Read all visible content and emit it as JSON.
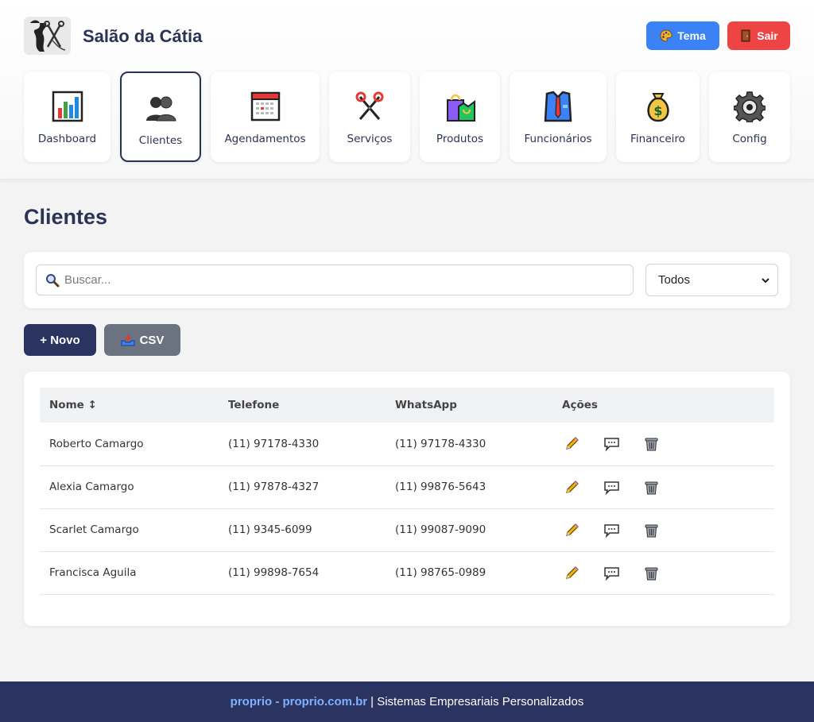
{
  "app": {
    "brand": "Salão da Cátia"
  },
  "header": {
    "theme_label": "Tema",
    "logout_label": "Sair"
  },
  "nav": [
    {
      "label": "Dashboard",
      "icon": "chart-icon"
    },
    {
      "label": "Clientes",
      "icon": "users-icon",
      "active": true
    },
    {
      "label": "Agendamentos",
      "icon": "calendar-icon"
    },
    {
      "label": "Serviços",
      "icon": "scissors-icon"
    },
    {
      "label": "Produtos",
      "icon": "shopping-bag-icon"
    },
    {
      "label": "Funcionários",
      "icon": "shirt-tie-icon"
    },
    {
      "label": "Financeiro",
      "icon": "money-bag-icon"
    },
    {
      "label": "Config",
      "icon": "gear-icon"
    }
  ],
  "page": {
    "title": "Clientes"
  },
  "filters": {
    "search_placeholder": "Buscar...",
    "select_value": "Todos"
  },
  "actions": {
    "new_label": "+ Novo",
    "csv_label": "CSV"
  },
  "table": {
    "headers": [
      "Nome ↕",
      "Telefone",
      "WhatsApp",
      "Ações"
    ],
    "rows": [
      {
        "name": "Roberto Camargo",
        "phone": "(11) 97178-4330",
        "whatsapp": "(11) 97178-4330"
      },
      {
        "name": "Alexia Camargo",
        "phone": "(11) 97878-4327",
        "whatsapp": "(11) 99876-5643"
      },
      {
        "name": "Scarlet Camargo",
        "phone": "(11) 9345-6099",
        "whatsapp": "(11) 99087-9090"
      },
      {
        "name": "Francisca Aguila",
        "phone": "(11) 99898-7654",
        "whatsapp": "(11) 98765-0989"
      }
    ]
  },
  "footer": {
    "link": "proprio - proprio.com.br",
    "text": "| Sistemas Empresariais Personalizados"
  },
  "colors": {
    "primary": "#2b3461",
    "theme_button": "#3b82f6",
    "logout_button": "#ef4444",
    "csv_button": "#6b7280"
  }
}
